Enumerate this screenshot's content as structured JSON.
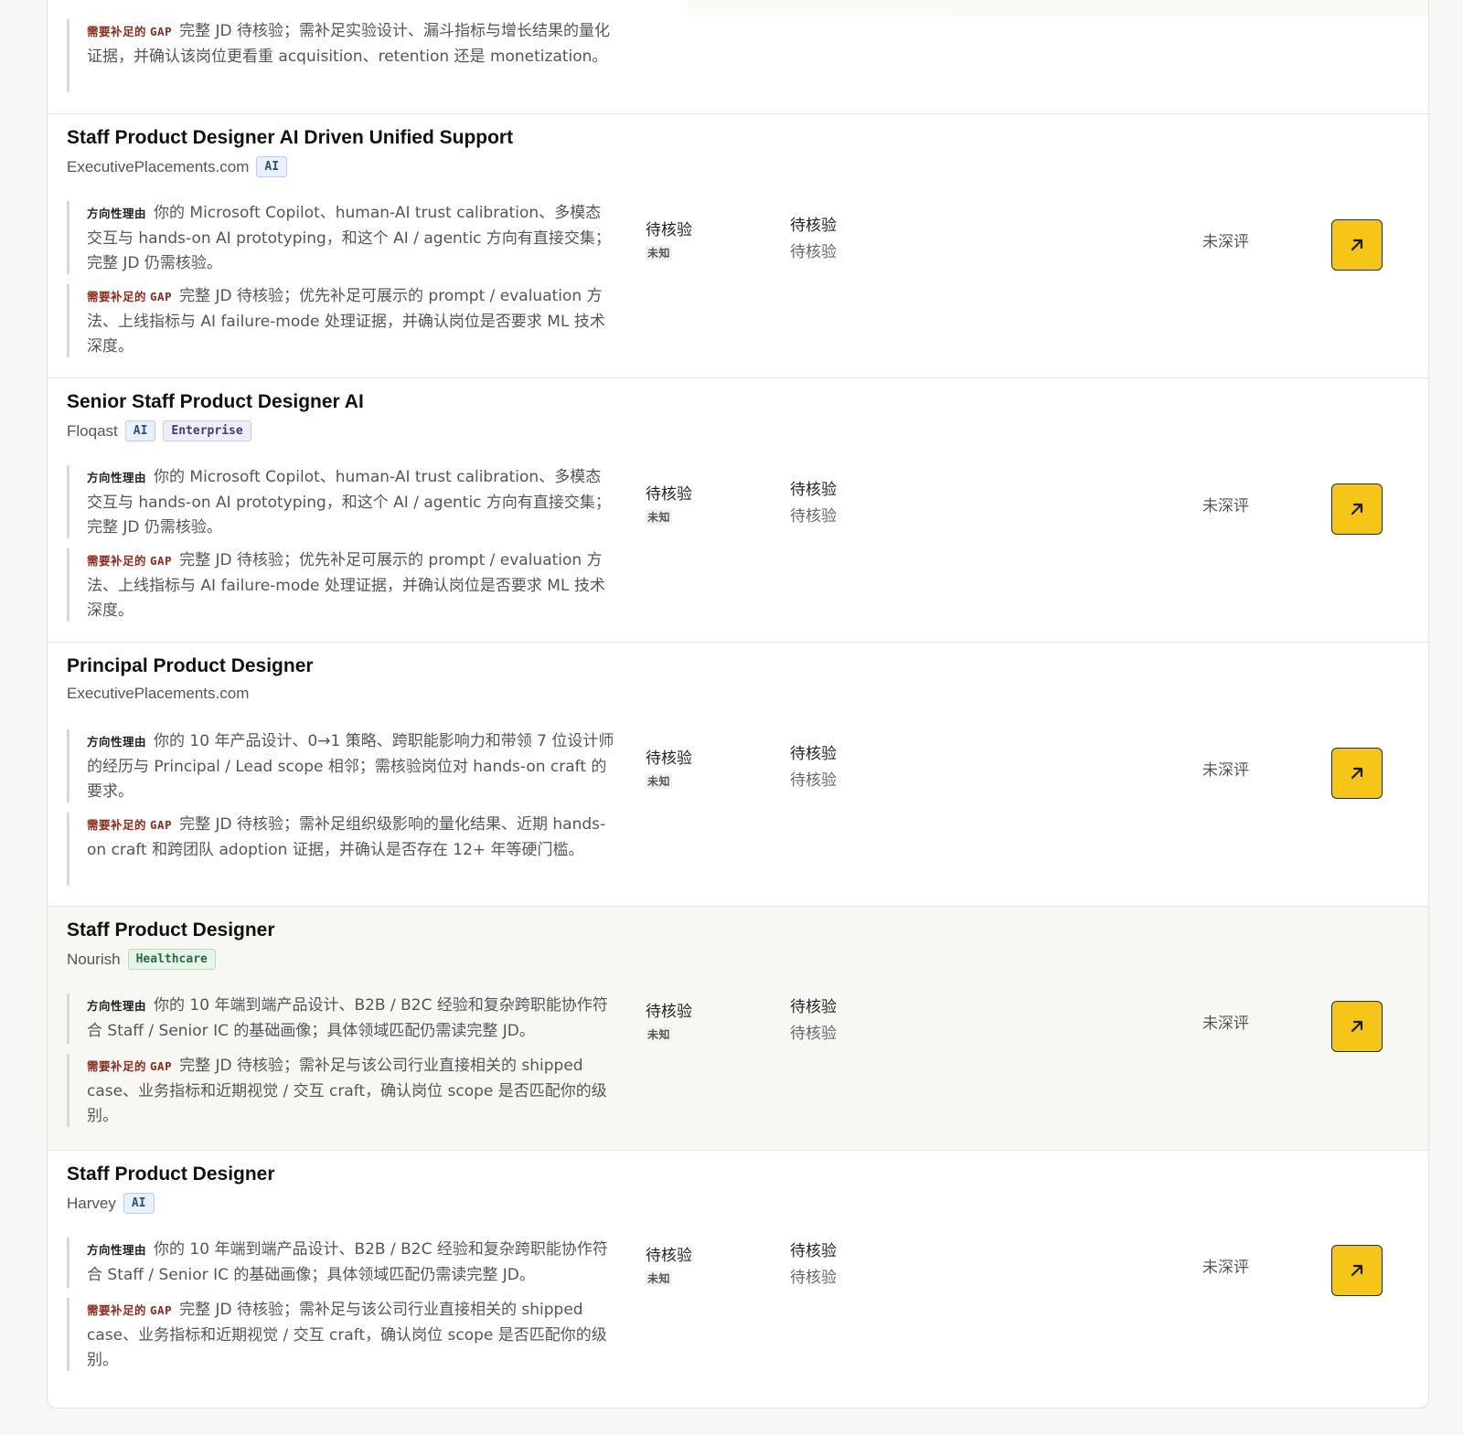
{
  "labels": {
    "reason_label": "方向性理由",
    "gap_label_cn": "需要补足的",
    "gap_label_en": "GAP"
  },
  "partial_row": {
    "gap_text": "完整 JD 待核验；需补足实验设计、漏斗指标与增长结果的量化证据，并确认该岗位更看重 acquisition、retention 还是 monetization。"
  },
  "rows": [
    {
      "title": "Staff Product Designer AI Driven Unified Support",
      "company": "ExecutivePlacements.com",
      "tags": [
        {
          "label": "AI",
          "kind": "ai"
        }
      ],
      "reason": "你的 Microsoft Copilot、human-AI trust calibration、多模态交互与 hands-on AI prototyping，和这个 AI / agentic 方向有直接交集；完整 JD 仍需核验。",
      "gap": "完整 JD 待核验；优先补足可展示的 prompt / evaluation 方法、上线指标与 AI failure-mode 处理证据，并确认岗位是否要求 ML 技术深度。",
      "col2_main": "待核验",
      "col2_sub": "未知",
      "col3_main": "待核验",
      "col3_sub": "待核验",
      "status": "未深评"
    },
    {
      "title": "Senior Staff Product Designer AI",
      "company": "Floqast",
      "tags": [
        {
          "label": "AI",
          "kind": "ai"
        },
        {
          "label": "Enterprise",
          "kind": "enterprise"
        }
      ],
      "reason": "你的 Microsoft Copilot、human-AI trust calibration、多模态交互与 hands-on AI prototyping，和这个 AI / agentic 方向有直接交集；完整 JD 仍需核验。",
      "gap": "完整 JD 待核验；优先补足可展示的 prompt / evaluation 方法、上线指标与 AI failure-mode 处理证据，并确认岗位是否要求 ML 技术深度。",
      "col2_main": "待核验",
      "col2_sub": "未知",
      "col3_main": "待核验",
      "col3_sub": "待核验",
      "status": "未深评"
    },
    {
      "title": "Principal Product Designer",
      "company": "ExecutivePlacements.com",
      "tags": [],
      "reason": "你的 10 年产品设计、0→1 策略、跨职能影响力和带领 7 位设计师的经历与 Principal / Lead scope 相邻；需核验岗位对 hands-on craft 的要求。",
      "gap": "完整 JD 待核验；需补足组织级影响的量化结果、近期 hands-on craft 和跨团队 adoption 证据，并确认是否存在 12+ 年等硬门槛。",
      "col2_main": "待核验",
      "col2_sub": "未知",
      "col3_main": "待核验",
      "col3_sub": "待核验",
      "status": "未深评"
    },
    {
      "title": "Staff Product Designer",
      "company": "Nourish",
      "tags": [
        {
          "label": "Healthcare",
          "kind": "healthcare"
        }
      ],
      "reason": "你的 10 年端到端产品设计、B2B / B2C 经验和复杂跨职能协作符合 Staff / Senior IC 的基础画像；具体领域匹配仍需读完整 JD。",
      "gap": "完整 JD 待核验；需补足与该公司行业直接相关的 shipped case、业务指标和近期视觉 / 交互 craft，确认岗位 scope 是否匹配你的级别。",
      "col2_main": "待核验",
      "col2_sub": "未知",
      "col3_main": "待核验",
      "col3_sub": "待核验",
      "status": "未深评"
    },
    {
      "title": "Staff Product Designer",
      "company": "Harvey",
      "tags": [
        {
          "label": "AI",
          "kind": "ai"
        }
      ],
      "reason": "你的 10 年端到端产品设计、B2B / B2C 经验和复杂跨职能协作符合 Staff / Senior IC 的基础画像；具体领域匹配仍需读完整 JD。",
      "gap": "完整 JD 待核验；需补足与该公司行业直接相关的 shipped case、业务指标和近期视觉 / 交互 craft，确认岗位 scope 是否匹配你的级别。",
      "col2_main": "待核验",
      "col2_sub": "未知",
      "col3_main": "待核验",
      "col3_sub": "待核验",
      "status": "未深评"
    }
  ],
  "icons": {
    "open": "arrow-up-right-icon"
  },
  "colors": {
    "accent": "#f5c518",
    "gap_label": "#8f2a1c"
  }
}
